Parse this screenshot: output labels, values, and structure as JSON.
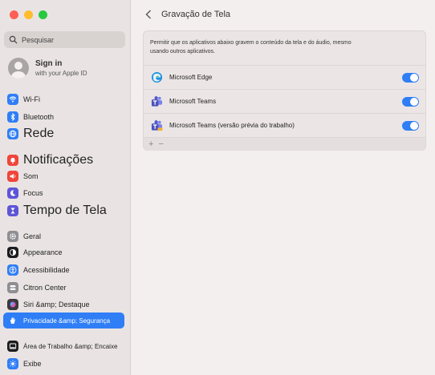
{
  "sidebar": {
    "search_placeholder": "Pesquisar",
    "account": {
      "name": "Sign in",
      "subtitle": "with your Apple ID"
    },
    "items": [
      {
        "label": "Wi-Fi",
        "icon": "wifi-icon",
        "color": "#2f7ef6"
      },
      {
        "label": "Bluetooth",
        "icon": "bluetooth-icon",
        "color": "#2f7ef6"
      },
      {
        "label": "Rede",
        "icon": "globe-icon",
        "color": "#2f7ef6"
      },
      {
        "label": "Notificações",
        "icon": "bell-icon",
        "color": "#f0453a"
      },
      {
        "label": "Som",
        "icon": "speaker-icon",
        "color": "#f0453a"
      },
      {
        "label": "Focus",
        "icon": "moon-icon",
        "color": "#5e55d6"
      },
      {
        "label": "Tempo de Tela",
        "icon": "hourglass-icon",
        "color": "#5e55d6"
      },
      {
        "label": "Geral",
        "icon": "gear-icon",
        "color": "#8e8e93"
      },
      {
        "label": "Appearance",
        "icon": "appearance-icon",
        "color": "#1c1c1e"
      },
      {
        "label": "Acessibilidade",
        "icon": "accessibility-icon",
        "color": "#2f7ef6"
      },
      {
        "label": "Citron Center",
        "icon": "control-center-icon",
        "color": "#8e8e93"
      },
      {
        "label": "Siri &amp; Destaque",
        "icon": "siri-icon",
        "color": "#3a3a3c"
      },
      {
        "label": "Privacidade &amp; Segurança",
        "icon": "hand-icon",
        "color": "#2f7ef6"
      },
      {
        "label": "Área de Trabalho &amp; Encaixe",
        "icon": "dock-icon",
        "color": "#1c1c1e"
      },
      {
        "label": "Exibe",
        "icon": "sun-icon",
        "color": "#2f7ef6"
      }
    ]
  },
  "main": {
    "title": "Gravação de Tela",
    "description": "Permitir que os aplicativos abaixo gravem o conteúdo da tela e do áudio, mesmo usando outros aplicativos.",
    "apps": [
      {
        "name": "Microsoft Edge",
        "icon": "edge-icon",
        "enabled": true
      },
      {
        "name": "Microsoft Teams",
        "icon": "teams-icon",
        "enabled": true
      },
      {
        "name": "Microsoft Teams (versão prévia do trabalho)",
        "icon": "teams-preview-icon",
        "enabled": true
      }
    ],
    "footer": {
      "add": "+",
      "remove": "−"
    }
  },
  "colors": {
    "accent": "#2f7ef6",
    "sidebar_bg": "#e9e4e3",
    "main_bg": "#f3efee"
  }
}
